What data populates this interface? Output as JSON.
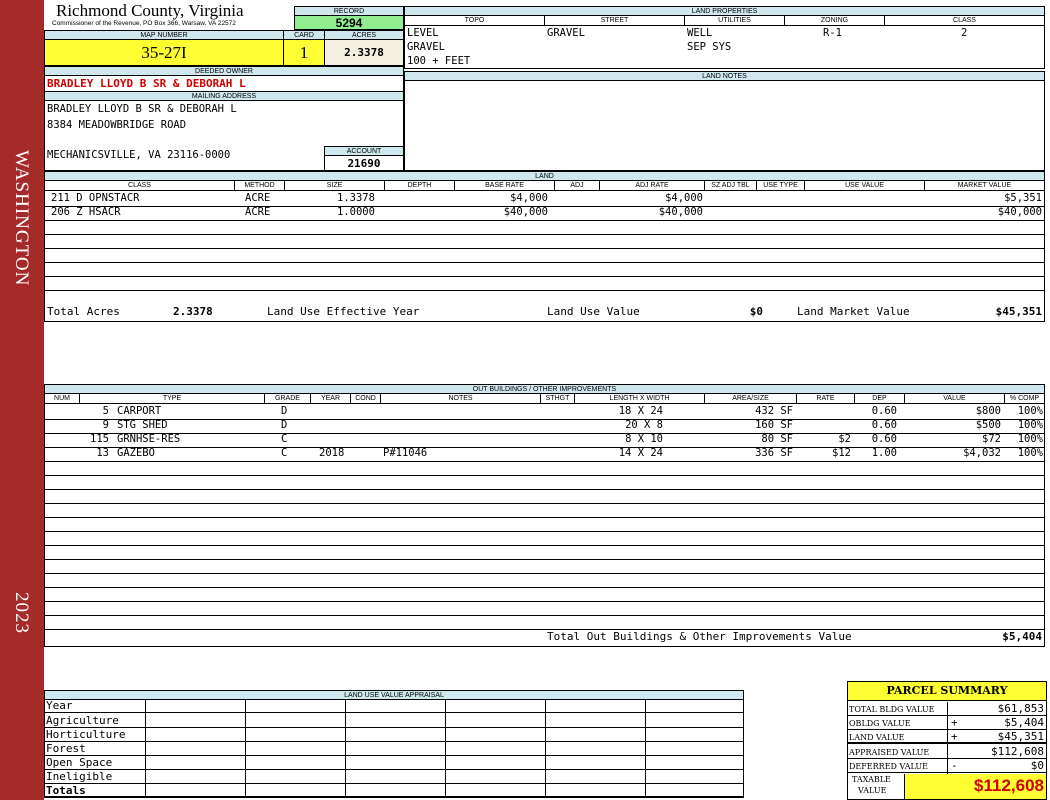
{
  "sidebar": {
    "district": "WASHINGTON",
    "year": "2023"
  },
  "header": {
    "county": "Richmond County, Virginia",
    "commissioner": "Commissioner of the Revenue, PO Box 366, Warsaw, VA 22572",
    "record_label": "RECORD",
    "record": "5294",
    "map_label": "MAP NUMBER",
    "map_number": "35-27I",
    "card_label": "CARD",
    "card": "1",
    "acres_label": "ACRES",
    "acres": "2.3378"
  },
  "owner": {
    "deeded_label": "DEEDED OWNER",
    "deeded": "BRADLEY LLOYD B SR & DEBORAH L",
    "mailing_label": "MAILING ADDRESS",
    "mail_line1": "BRADLEY LLOYD B SR & DEBORAH L",
    "mail_line2": "8384 MEADOWBRIDGE ROAD",
    "mail_line3": "MECHANICSVILLE, VA 23116-0000",
    "account_label": "ACCOUNT",
    "account": "21690"
  },
  "land_properties": {
    "title": "LAND PROPERTIES",
    "cols": [
      "TOPO",
      "STREET",
      "UTILITIES",
      "ZONING",
      "CLASS"
    ],
    "topo": [
      "LEVEL",
      "GRAVEL",
      "100 + FEET"
    ],
    "street": "GRAVEL",
    "utilities": [
      "WELL",
      "SEP SYS"
    ],
    "zoning": "R-1",
    "class": "2"
  },
  "land_notes_label": "LAND NOTES",
  "land": {
    "title": "LAND",
    "cols": [
      "CLASS",
      "METHOD",
      "SIZE",
      "DEPTH",
      "BASE RATE",
      "ADJ",
      "ADJ RATE",
      "SZ ADJ TBL",
      "USE TYPE",
      "USE VALUE",
      "MARKET VALUE"
    ],
    "rows": [
      {
        "class": "211 D OPNSTACR",
        "method": "ACRE",
        "size": "1.3378",
        "base": "$4,000",
        "adjrate": "$4,000",
        "market": "$5,351"
      },
      {
        "class": "206 Z HSACR",
        "method": "ACRE",
        "size": "1.0000",
        "base": "$40,000",
        "adjrate": "$40,000",
        "market": "$40,000"
      }
    ],
    "total_acres_label": "Total Acres",
    "total_acres": "2.3378",
    "effective_year_label": "Land Use Effective Year",
    "use_value_label": "Land Use Value",
    "use_value": "$0",
    "market_value_label": "Land Market Value",
    "market_value": "$45,351"
  },
  "outbuildings": {
    "title": "OUT BUILDINGS / OTHER IMPROVEMENTS",
    "cols": [
      "NUM",
      "TYPE",
      "GRADE",
      "YEAR",
      "COND",
      "NOTES",
      "STHGT",
      "LENGTH X WIDTH",
      "AREA/SIZE",
      "RATE",
      "DEP",
      "VALUE",
      "% COMP"
    ],
    "rows": [
      {
        "num": "5",
        "type": "CARPORT",
        "grade": "D",
        "year": "",
        "notes": "",
        "lw": "18 X 24",
        "area": "432 SF",
        "rate": "",
        "dep": "0.60",
        "value": "$800",
        "comp": "100%"
      },
      {
        "num": "9",
        "type": "STG SHED",
        "grade": "D",
        "year": "",
        "notes": "",
        "lw": "20 X 8",
        "area": "160 SF",
        "rate": "",
        "dep": "0.60",
        "value": "$500",
        "comp": "100%"
      },
      {
        "num": "115",
        "type": "GRNHSE-RES",
        "grade": "C",
        "year": "",
        "notes": "",
        "lw": "8 X 10",
        "area": "80 SF",
        "rate": "$2",
        "dep": "0.60",
        "value": "$72",
        "comp": "100%"
      },
      {
        "num": "13",
        "type": "GAZEBO",
        "grade": "C",
        "year": "2018",
        "notes": "P#11046",
        "lw": "14 X 24",
        "area": "336 SF",
        "rate": "$12",
        "dep": "1.00",
        "value": "$4,032",
        "comp": "100%"
      }
    ],
    "total_label": "Total Out Buildings & Other Improvements Value",
    "total": "$5,404"
  },
  "land_use_appraisal": {
    "title": "LAND USE VALUE APPRAISAL",
    "rows": [
      "Year",
      "Agriculture",
      "Horticulture",
      "Forest",
      "Open Space",
      "Ineligible",
      "Totals"
    ]
  },
  "parcel_summary": {
    "title": "PARCEL SUMMARY",
    "total_bldg_label": "TOTAL BLDG VALUE",
    "total_bldg": "$61,853",
    "obldg_label": "OBLDG VALUE",
    "obldg_sign": "+",
    "obldg": "$5,404",
    "land_label": "LAND VALUE",
    "land_sign": "+",
    "land": "$45,351",
    "appraised_label": "APPRAISED VALUE",
    "appraised": "$112,608",
    "deferred_label": "DEFERRED VALUE",
    "deferred_sign": "-",
    "deferred": "$0",
    "taxable_label1": "TAXABLE",
    "taxable_label2": "VALUE",
    "taxable": "$112,608"
  }
}
